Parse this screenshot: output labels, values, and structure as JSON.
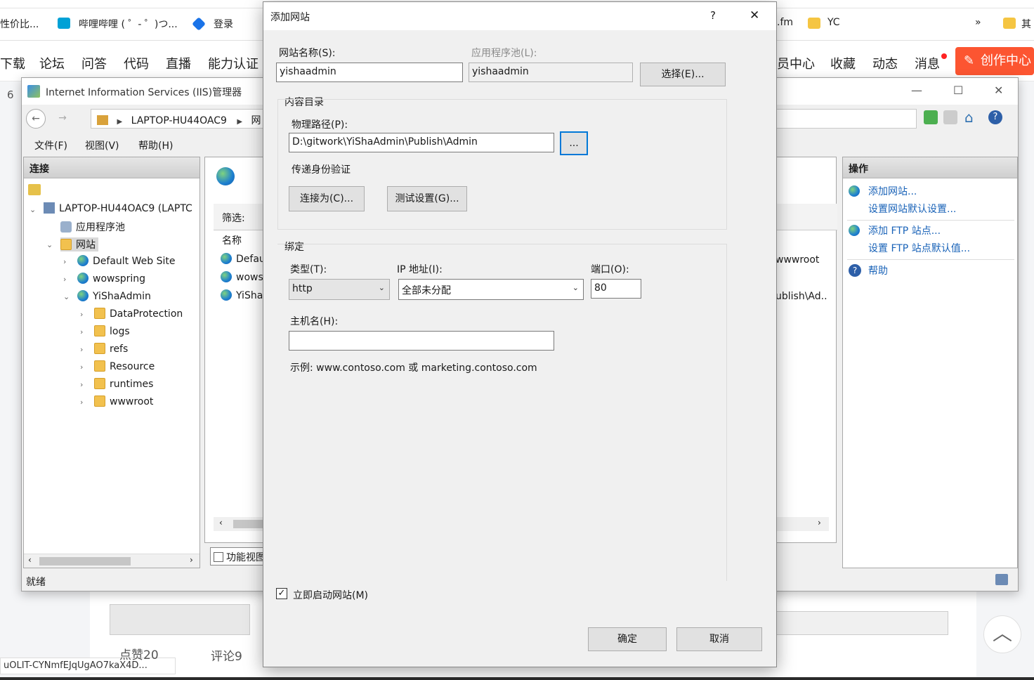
{
  "browser": {
    "bookmarks": [
      "性价比...",
      "哔哩哔哩 ( ゜- ゜)つ...",
      "登录",
      ".fm",
      "YC",
      "»",
      "其"
    ],
    "nav": [
      "下载",
      "论坛",
      "问答",
      "代码",
      "直播",
      "能力认证",
      "员中心",
      "收藏",
      "动态",
      "消息"
    ],
    "create_label": "创作中心",
    "side_count": "6",
    "bottom_link": "uOLIT-CYNmfEJqUgAO7kaX4D...",
    "comments": "评论9",
    "likes": "点赞20"
  },
  "iis": {
    "title": "Internet Information Services (IIS)管理器",
    "breadcrumb": [
      "LAPTOP-HU44OAC9",
      "网"
    ],
    "menu": [
      "文件(F)",
      "视图(V)",
      "帮助(H)"
    ],
    "connections_title": "连接",
    "tree": {
      "server": "LAPTOP-HU44OAC9 (LAPTC",
      "app_pools": "应用程序池",
      "sites": "网站",
      "site_items": [
        "Default Web Site",
        "wowspring",
        "YiShaAdmin"
      ],
      "folders": [
        "DataProtection",
        "logs",
        "refs",
        "Resource",
        "runtimes",
        "wwwroot"
      ]
    },
    "filter_label": "筛选:",
    "name_col": "名称",
    "list_rows": [
      "Defau",
      "wows",
      "YiSha"
    ],
    "right_cells": [
      "wwwroot",
      "ublish\\Ad.."
    ],
    "feature_view": "功能视图",
    "actions_title": "操作",
    "actions": [
      "添加网站...",
      "设置网站默认设置...",
      "添加 FTP 站点...",
      "设置 FTP 站点默认值...",
      "帮助"
    ],
    "status": "就绪"
  },
  "dialog": {
    "title": "添加网站",
    "help": "?",
    "site_name_label": "网站名称(S):",
    "site_name_value": "yishaadmin",
    "app_pool_label": "应用程序池(L):",
    "app_pool_value": "yishaadmin",
    "select_button": "选择(E)...",
    "content_dir_label": "内容目录",
    "physical_path_label": "物理路径(P):",
    "physical_path_value": "D:\\gitwork\\YiShaAdmin\\Publish\\Admin",
    "browse_button": "...",
    "pass_auth_label": "传递身份验证",
    "connect_as_button": "连接为(C)...",
    "test_settings_button": "测试设置(G)...",
    "binding_label": "绑定",
    "type_label": "类型(T):",
    "type_value": "http",
    "ip_label": "IP 地址(I):",
    "ip_value": "全部未分配",
    "port_label": "端口(O):",
    "port_value": "80",
    "host_label": "主机名(H):",
    "host_value": "",
    "example_text": "示例: www.contoso.com 或 marketing.contoso.com",
    "start_checkbox_label": "立即启动网站(M)",
    "start_checked": true,
    "ok_button": "确定",
    "cancel_button": "取消"
  },
  "colors": {
    "accent": "#fc5531",
    "link": "#1a63b8",
    "focus": "#0078d7"
  }
}
